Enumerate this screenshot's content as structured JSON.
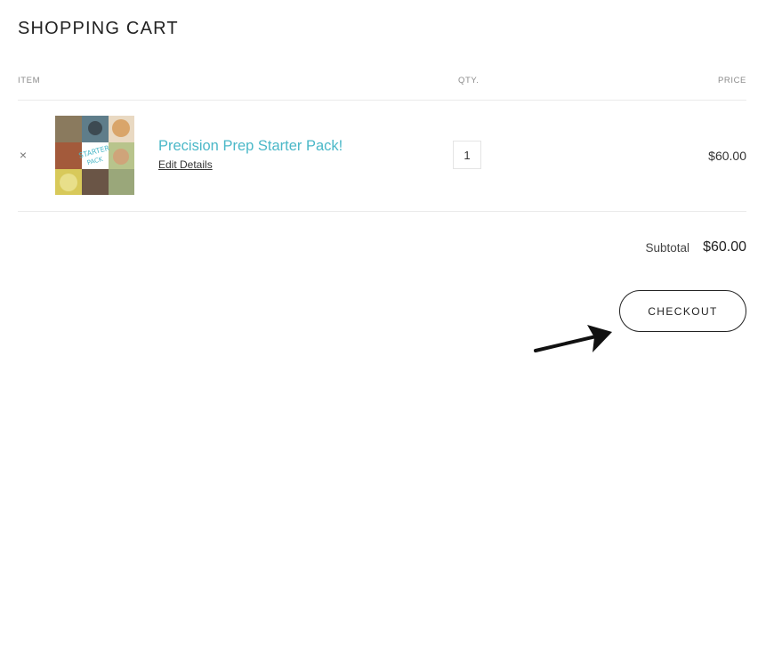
{
  "cart": {
    "title": "SHOPPING CART",
    "columns": {
      "item": "ITEM",
      "qty": "QTY.",
      "price": "PRICE"
    },
    "items": [
      {
        "remove_glyph": "×",
        "name": "Precision Prep Starter Pack!",
        "edit_label": "Edit Details",
        "quantity": "1",
        "price": "$60.00",
        "thumbnail_icon": "product-collage-thumbnail"
      }
    ],
    "subtotal": {
      "label": "Subtotal",
      "value": "$60.00"
    },
    "checkout_label": "CHECKOUT"
  },
  "colors": {
    "accent": "#4bb8c8",
    "text": "#2b2b2b",
    "muted": "#8a8a8a",
    "border": "#eaeaea"
  },
  "annotation": {
    "arrow_icon": "arrow-pointing-to-checkout"
  }
}
